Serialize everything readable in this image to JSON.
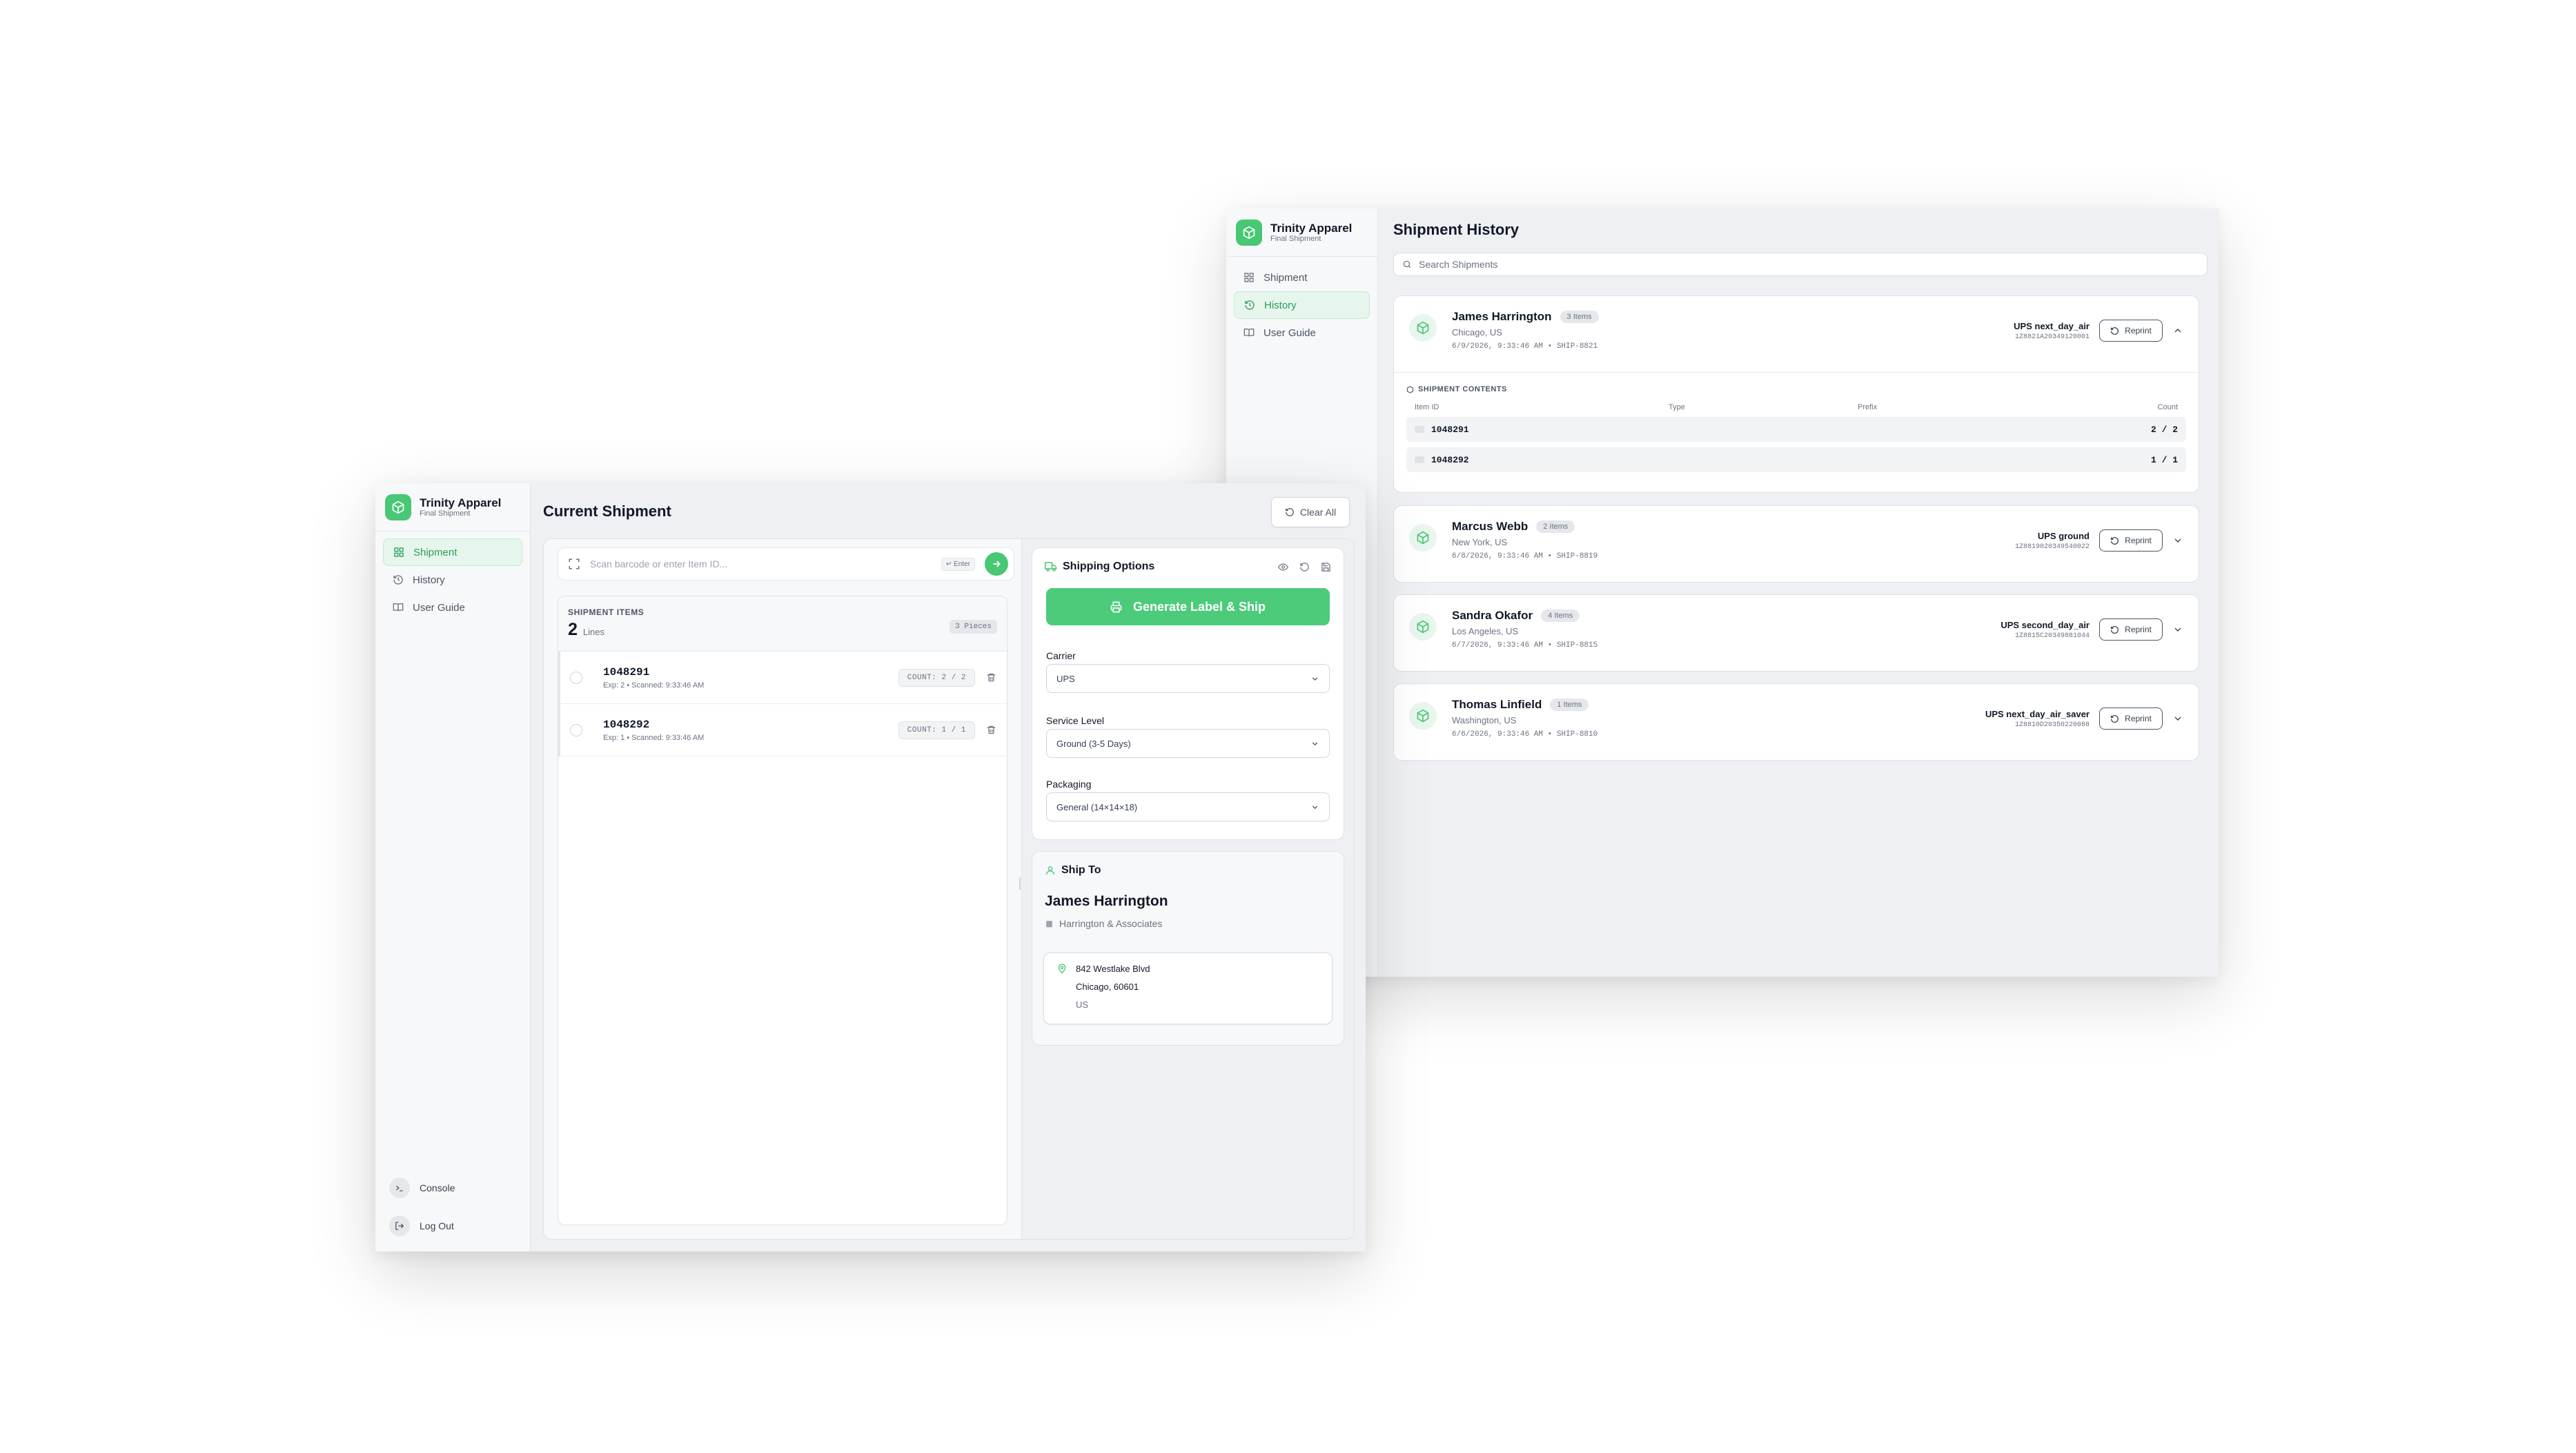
{
  "brand": {
    "name": "Trinity Apparel",
    "subtitle": "Final Shipment"
  },
  "nav": {
    "shipment": "Shipment",
    "history": "History",
    "user_guide": "User Guide"
  },
  "footer_nav": {
    "console": "Console",
    "logout": "Log Out"
  },
  "colors": {
    "accent": "#48c774",
    "accent_soft": "#e6f6ec"
  },
  "shipment": {
    "title": "Current Shipment",
    "clear_all": "Clear All",
    "scan_placeholder": "Scan barcode or enter Item ID...",
    "enter_hint": "↵ Enter",
    "items_label": "SHIPMENT ITEMS",
    "lines_count": "2",
    "lines_label": "Lines",
    "pieces": "3 Pieces",
    "items": [
      {
        "id": "1048291",
        "meta": "Exp: 2 • Scanned: 9:33:46 AM",
        "count": "COUNT: 2 / 2"
      },
      {
        "id": "1048292",
        "meta": "Exp: 1 • Scanned: 9:33:46 AM",
        "count": "COUNT: 1 / 1"
      }
    ],
    "options": {
      "title": "Shipping Options",
      "generate": "Generate Label & Ship",
      "carrier_label": "Carrier",
      "carrier": "UPS",
      "service_label": "Service Level",
      "service": "Ground (3-5 Days)",
      "packaging_label": "Packaging",
      "packaging": "General (14×14×18)"
    },
    "ship_to": {
      "title": "Ship To",
      "name": "James Harrington",
      "company": "Harrington & Associates",
      "street": "842 Westlake Blvd",
      "city": "Chicago, 60601",
      "country": "US"
    }
  },
  "history": {
    "title": "Shipment History",
    "search_placeholder": "Search Shipments",
    "reprint": "Reprint",
    "contents_title": "SHIPMENT CONTENTS",
    "contents_headers": [
      "Item ID",
      "Type",
      "Prefix",
      "Count"
    ],
    "contents_rows": [
      {
        "id": "1048291",
        "count": "2 / 2"
      },
      {
        "id": "1048292",
        "count": "1 / 1"
      }
    ],
    "shipments": [
      {
        "name": "James Harrington",
        "items": "3 Items",
        "location": "Chicago, US",
        "meta": "6/9/2026, 9:33:46 AM • SHIP-8821",
        "service": "UPS next_day_air",
        "tracking": "1Z8821A20349120001"
      },
      {
        "name": "Marcus Webb",
        "items": "2 Items",
        "location": "New York, US",
        "meta": "6/8/2026, 9:33:46 AM • SHIP-8819",
        "service": "UPS ground",
        "tracking": "1Z8819020349540022"
      },
      {
        "name": "Sandra Okafor",
        "items": "4 Items",
        "location": "Los Angeles, US",
        "meta": "6/7/2026, 9:33:46 AM • SHIP-8815",
        "service": "UPS second_day_air",
        "tracking": "1Z8815C20349881044"
      },
      {
        "name": "Thomas Linfield",
        "items": "1 Items",
        "location": "Washington, US",
        "meta": "6/6/2026, 9:33:46 AM • SHIP-8810",
        "service": "UPS next_day_air_saver",
        "tracking": "1Z8810D20350220088"
      }
    ]
  }
}
